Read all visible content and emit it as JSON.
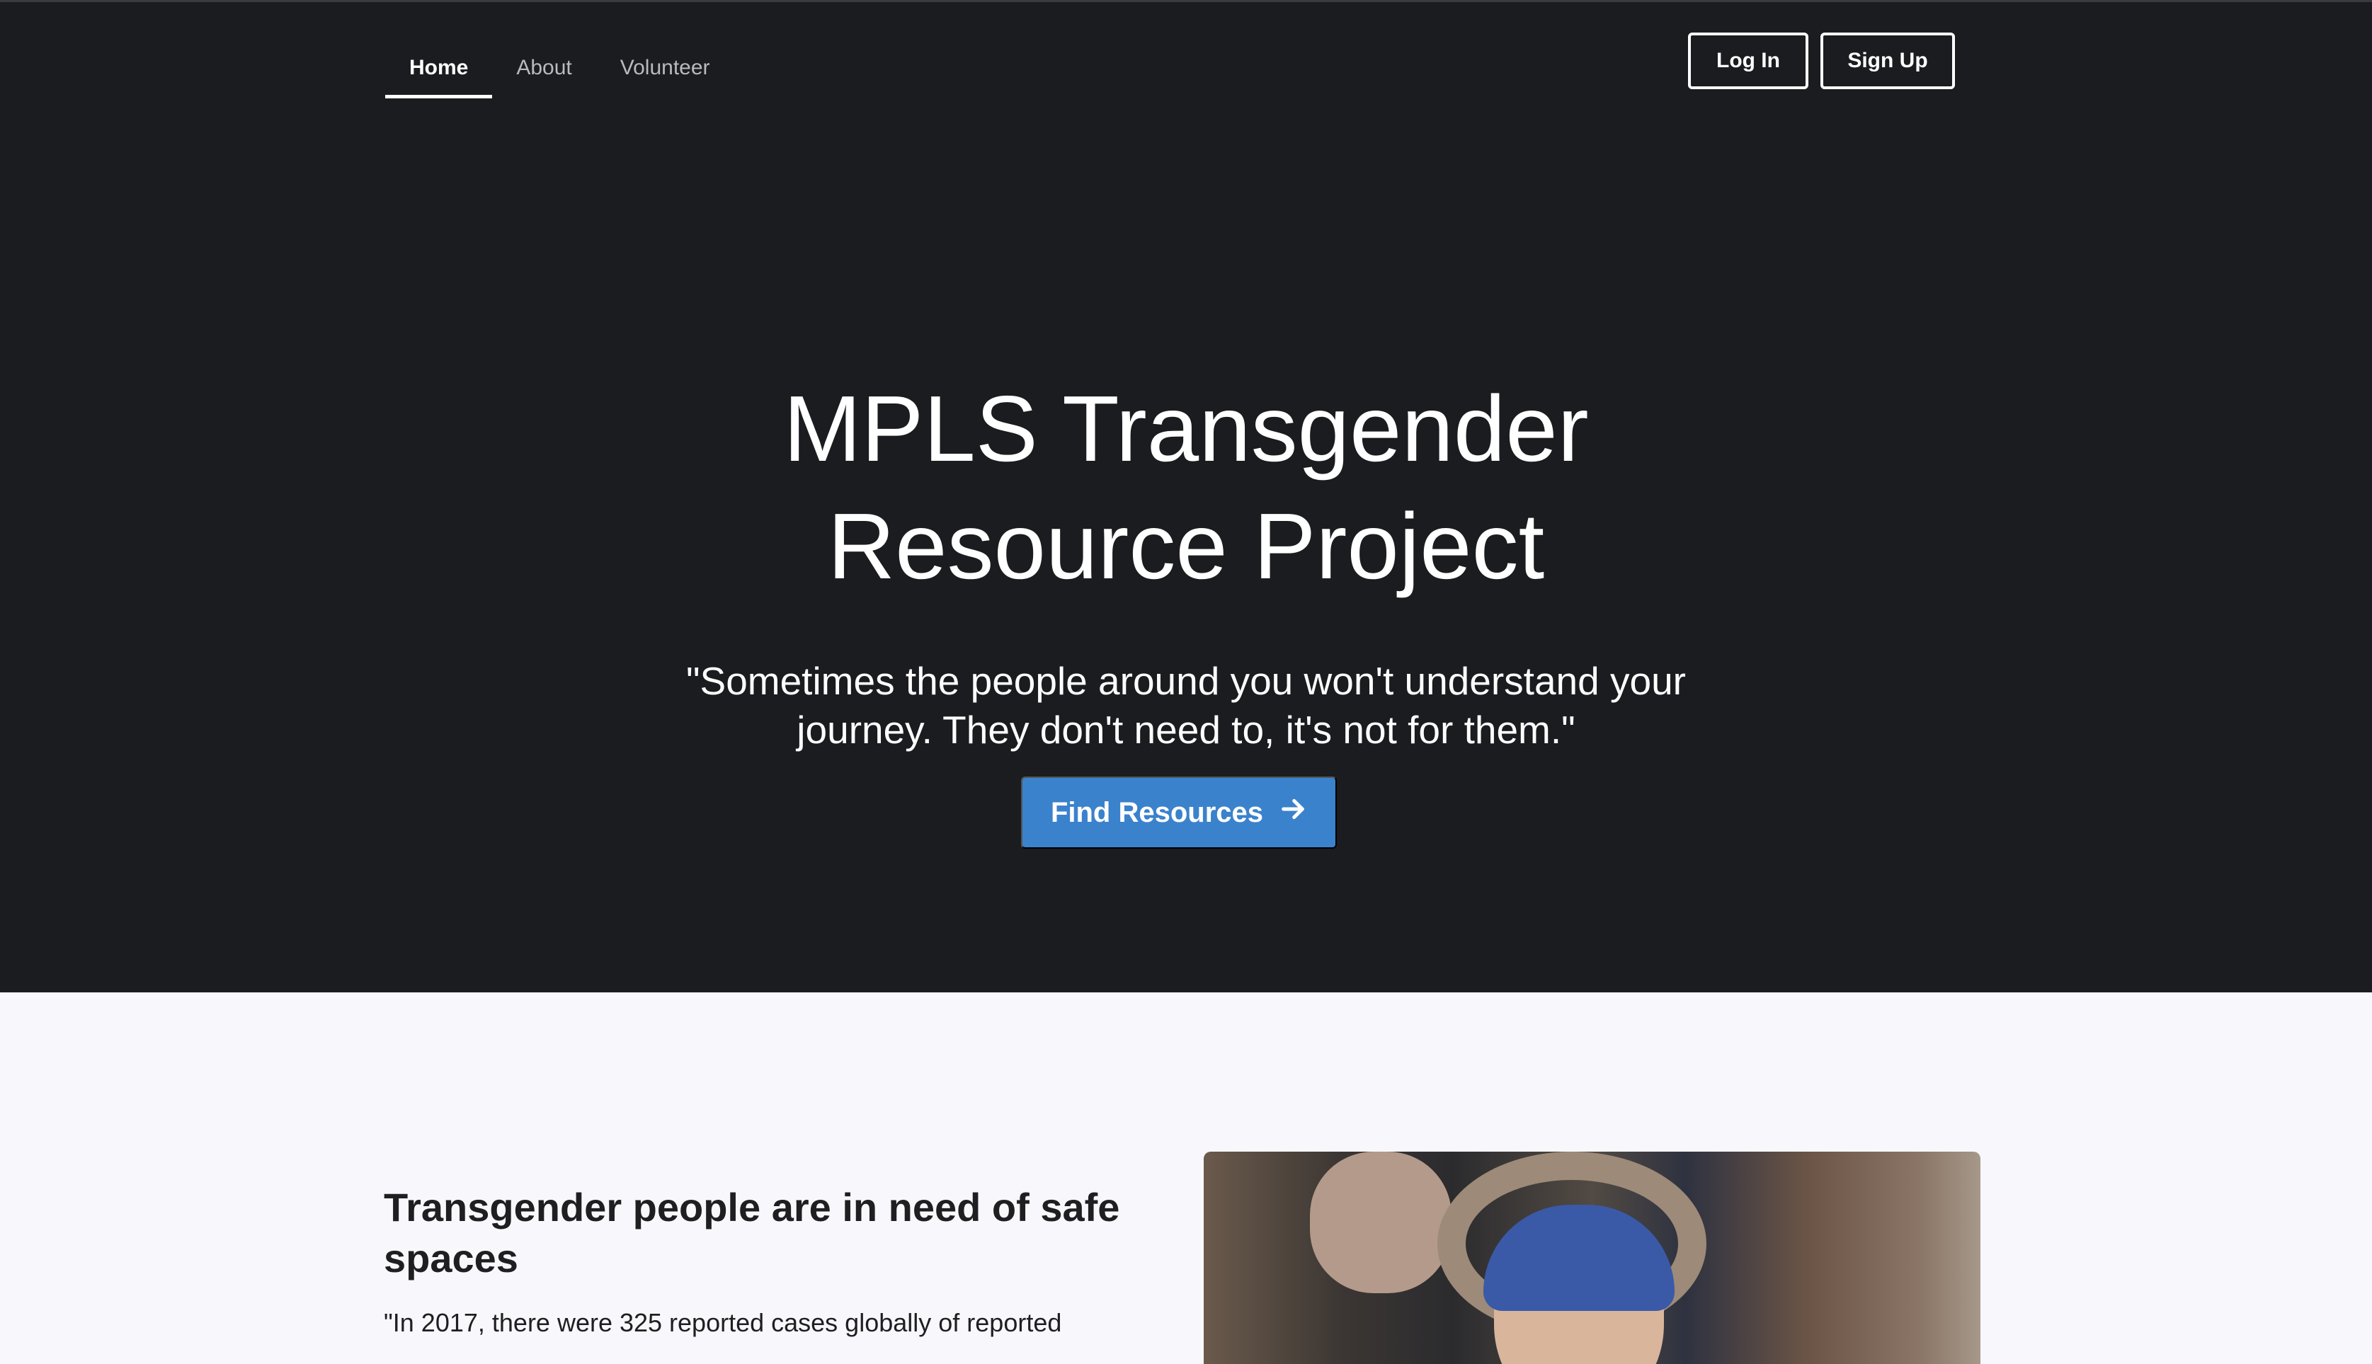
{
  "nav": {
    "items": [
      {
        "label": "Home",
        "active": true
      },
      {
        "label": "About",
        "active": false
      },
      {
        "label": "Volunteer",
        "active": false
      }
    ]
  },
  "auth": {
    "login_label": "Log In",
    "signup_label": "Sign Up"
  },
  "hero": {
    "title_line1": "MPLS Transgender",
    "title_line2": "Resource Project",
    "quote_line1": "\"Sometimes the people around you won't understand your",
    "quote_line2": "journey. They don't need to, it's not for them.\"",
    "cta_label": "Find Resources",
    "cta_icon": "arrow-right-icon"
  },
  "section": {
    "heading_line1": "Transgender people are in need of safe",
    "heading_line2": "spaces",
    "text": "\"In 2017, there were 325 reported cases globally of reported",
    "image_alt": "crowd-photo"
  },
  "colors": {
    "hero_bg": "#1b1c1f",
    "page_bg": "#f8f8fc",
    "accent": "#3b82cc"
  }
}
